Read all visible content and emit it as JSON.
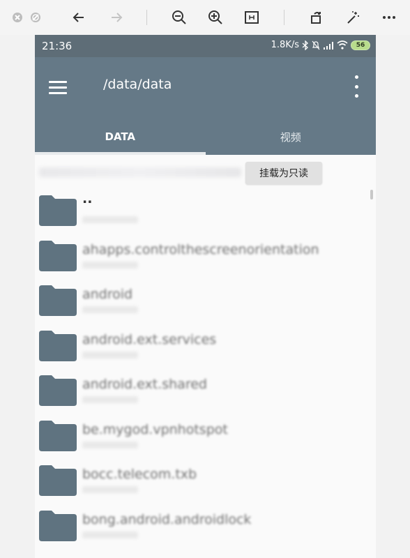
{
  "viewer": {
    "icons": [
      "close-icon",
      "stop-icon",
      "back-arrow-icon",
      "forward-arrow-icon",
      "zoom-out-icon",
      "zoom-in-icon",
      "fit-page-icon",
      "rotate-icon",
      "magic-wand-icon",
      "more-icon"
    ]
  },
  "status_bar": {
    "time": "21:36",
    "speed": "1.8K/s",
    "battery": "56"
  },
  "app_bar": {
    "path": "/data/data"
  },
  "tabs": [
    {
      "label": "DATA",
      "active": true
    },
    {
      "label": "视频",
      "active": false
    }
  ],
  "mount_button": "挂载为只读",
  "files": [
    {
      "name": ".."
    },
    {
      "name": "ahapps.controlthescreenorientation"
    },
    {
      "name": "android"
    },
    {
      "name": "android.ext.services"
    },
    {
      "name": "android.ext.shared"
    },
    {
      "name": "be.mygod.vpnhotspot"
    },
    {
      "name": "bocc.telecom.txb"
    },
    {
      "name": "bong.android.androidlock"
    }
  ],
  "colors": {
    "app_bar": "#657987",
    "status_bar": "#5e6d77",
    "folder": "#5f7380"
  }
}
